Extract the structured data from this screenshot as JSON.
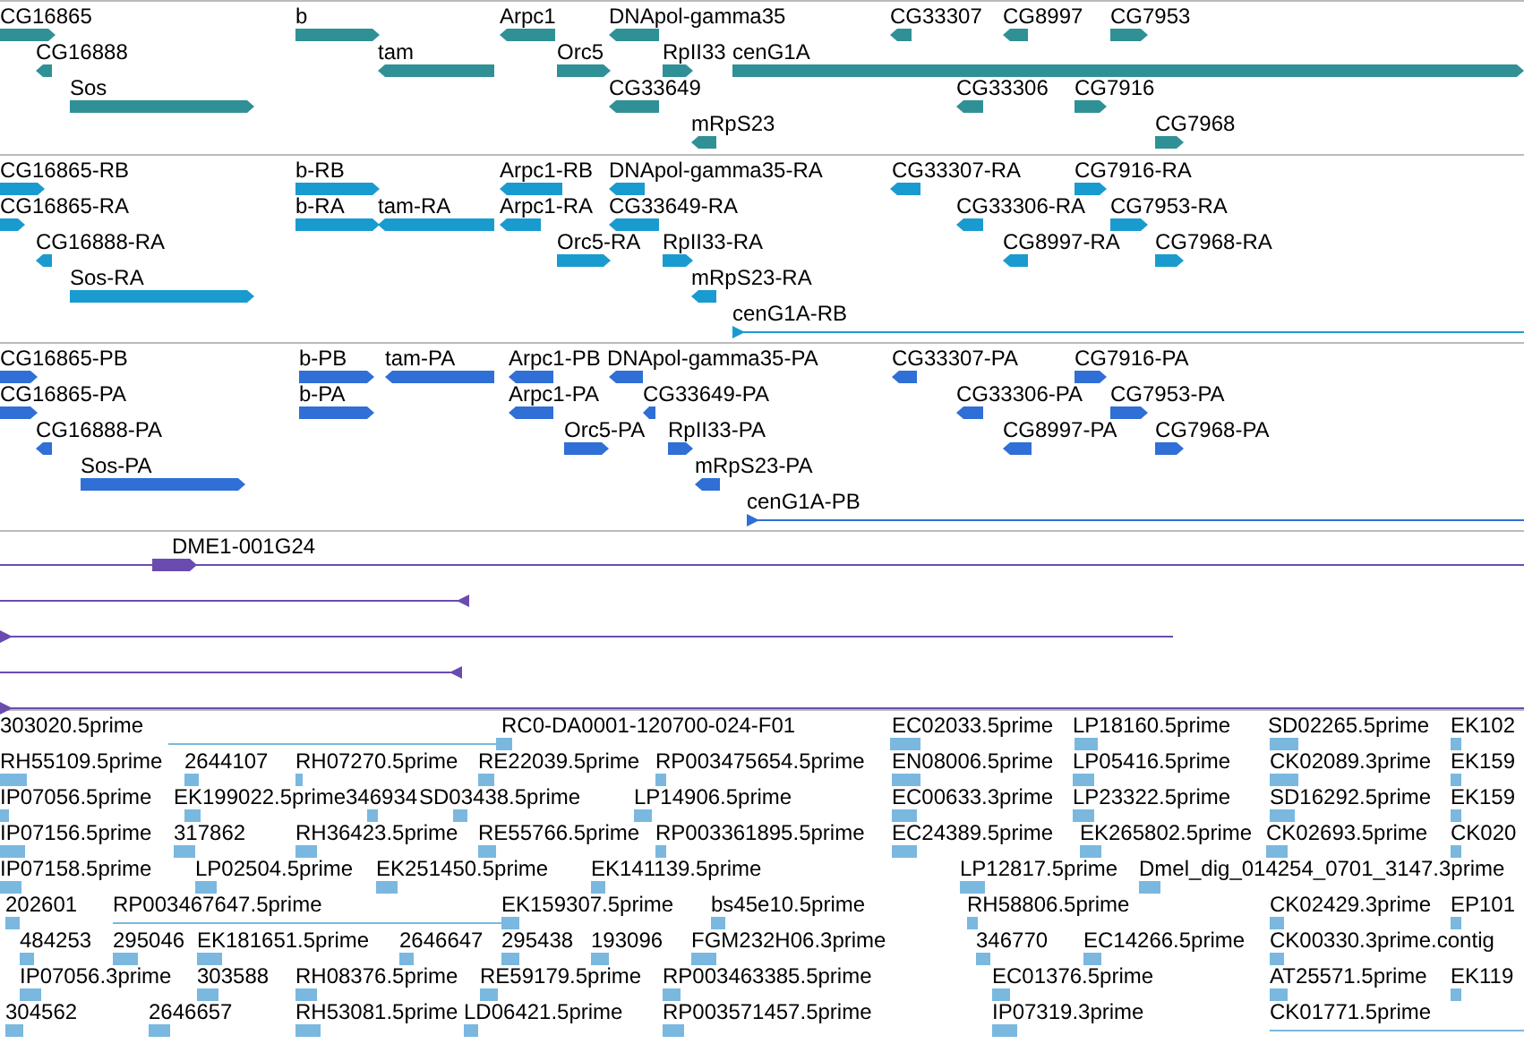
{
  "tracks": [
    {
      "kind": "gene",
      "features": [
        {
          "label": "CG16865",
          "reverse": false
        },
        {
          "label": "b",
          "reverse": false
        },
        {
          "label": "Arpc1",
          "reverse": true
        },
        {
          "label": "DNApol-gamma35",
          "reverse": true
        },
        {
          "label": "CG33307",
          "reverse": true
        },
        {
          "label": "CG8997",
          "reverse": true
        },
        {
          "label": "CG7953",
          "reverse": false
        },
        {
          "label": "CG16888",
          "reverse": true
        },
        {
          "label": "tam",
          "reverse": true
        },
        {
          "label": "Orc5",
          "reverse": false
        },
        {
          "label": "RpII33",
          "reverse": false
        },
        {
          "label": "cenG1A",
          "reverse": false
        },
        {
          "label": "Sos",
          "reverse": false
        },
        {
          "label": "CG33649",
          "reverse": true
        },
        {
          "label": "CG33306",
          "reverse": true
        },
        {
          "label": "CG7916",
          "reverse": false
        },
        {
          "label": "mRpS23",
          "reverse": true
        },
        {
          "label": "CG7968",
          "reverse": false
        }
      ]
    },
    {
      "kind": "transcript",
      "features": [
        {
          "label": "CG16865-RB",
          "reverse": false
        },
        {
          "label": "b-RB",
          "reverse": false
        },
        {
          "label": "Arpc1-RB",
          "reverse": true
        },
        {
          "label": "DNApol-gamma35-RA",
          "reverse": true
        },
        {
          "label": "CG33307-RA",
          "reverse": true
        },
        {
          "label": "CG7916-RA",
          "reverse": false
        },
        {
          "label": "CG16865-RA",
          "reverse": false
        },
        {
          "label": "b-RA",
          "reverse": false
        },
        {
          "label": "tam-RA",
          "reverse": true
        },
        {
          "label": "Arpc1-RA",
          "reverse": true
        },
        {
          "label": "CG33649-RA",
          "reverse": true
        },
        {
          "label": "CG33306-RA",
          "reverse": true
        },
        {
          "label": "CG7953-RA",
          "reverse": false
        },
        {
          "label": "CG16888-RA",
          "reverse": true
        },
        {
          "label": "Orc5-RA",
          "reverse": false
        },
        {
          "label": "RpII33-RA",
          "reverse": false
        },
        {
          "label": "CG8997-RA",
          "reverse": true
        },
        {
          "label": "CG7968-RA",
          "reverse": false
        },
        {
          "label": "Sos-RA",
          "reverse": false
        },
        {
          "label": "mRpS23-RA",
          "reverse": true
        },
        {
          "label": "cenG1A-RB",
          "reverse": false
        }
      ]
    },
    {
      "kind": "protein",
      "features": [
        {
          "label": "CG16865-PB",
          "reverse": false
        },
        {
          "label": "b-PB",
          "reverse": false
        },
        {
          "label": "tam-PA",
          "reverse": true
        },
        {
          "label": "Arpc1-PB",
          "reverse": true
        },
        {
          "label": "DNApol-gamma35-PA",
          "reverse": true
        },
        {
          "label": "CG33307-PA",
          "reverse": true
        },
        {
          "label": "CG7916-PA",
          "reverse": false
        },
        {
          "label": "CG16865-PA",
          "reverse": false
        },
        {
          "label": "b-PA",
          "reverse": false
        },
        {
          "label": "Arpc1-PA",
          "reverse": true
        },
        {
          "label": "CG33649-PA",
          "reverse": true
        },
        {
          "label": "CG33306-PA",
          "reverse": true
        },
        {
          "label": "CG7953-PA",
          "reverse": false
        },
        {
          "label": "CG16888-PA",
          "reverse": true
        },
        {
          "label": "Orc5-PA",
          "reverse": false
        },
        {
          "label": "RpII33-PA",
          "reverse": false
        },
        {
          "label": "CG8997-PA",
          "reverse": true
        },
        {
          "label": "CG7968-PA",
          "reverse": false
        },
        {
          "label": "Sos-PA",
          "reverse": false
        },
        {
          "label": "mRpS23-PA",
          "reverse": true
        },
        {
          "label": "cenG1A-PB",
          "reverse": false
        }
      ]
    },
    {
      "kind": "clone",
      "features": [
        {
          "label": "DME1-001G24",
          "reverse": false
        },
        {
          "reverse": true
        },
        {
          "reverse": false
        },
        {
          "reverse": true
        },
        {
          "reverse": false
        }
      ]
    },
    {
      "kind": "est",
      "features": [
        {
          "label": "303020.5prime"
        },
        {
          "label": "RC0-DA0001-120700-024-F01"
        },
        {
          "label": "EC02033.5prime"
        },
        {
          "label": "LP18160.5prime"
        },
        {
          "label": "SD02265.5prime"
        },
        {
          "label": "EK102"
        },
        {
          "label": "RH55109.5prime"
        },
        {
          "label": "2644107"
        },
        {
          "label": "RH07270.5prime"
        },
        {
          "label": "RE22039.5prime"
        },
        {
          "label": "RP003475654.5prime"
        },
        {
          "label": "EN08006.5prime"
        },
        {
          "label": "LP05416.5prime"
        },
        {
          "label": "CK02089.3prime"
        },
        {
          "label": "EK159"
        },
        {
          "label": "IP07056.5prime"
        },
        {
          "label": "EK199022.5prime"
        },
        {
          "label": "346934"
        },
        {
          "label": "SD03438.5prime"
        },
        {
          "label": "LP14906.5prime"
        },
        {
          "label": "EC00633.3prime"
        },
        {
          "label": "LP23322.5prime"
        },
        {
          "label": "SD16292.5prime"
        },
        {
          "label": "EK159"
        },
        {
          "label": "IP07156.5prime"
        },
        {
          "label": "317862"
        },
        {
          "label": "RH36423.5prime"
        },
        {
          "label": "RE55766.5prime"
        },
        {
          "label": "RP003361895.5prime"
        },
        {
          "label": "EC24389.5prime"
        },
        {
          "label": "EK265802.5prime"
        },
        {
          "label": "CK02693.5prime"
        },
        {
          "label": "CK020"
        },
        {
          "label": "IP07158.5prime"
        },
        {
          "label": "LP02504.5prime"
        },
        {
          "label": "EK251450.5prime"
        },
        {
          "label": "EK141139.5prime"
        },
        {
          "label": "LP12817.5prime"
        },
        {
          "label": "Dmel_dig_014254_0701_3147.3prime"
        },
        {
          "label": "202601"
        },
        {
          "label": "RP003467647.5prime"
        },
        {
          "label": "EK159307.5prime"
        },
        {
          "label": "bs45e10.5prime"
        },
        {
          "label": "RH58806.5prime"
        },
        {
          "label": "CK02429.3prime"
        },
        {
          "label": "EP101"
        },
        {
          "label": "484253"
        },
        {
          "label": "295046"
        },
        {
          "label": "EK181651.5prime"
        },
        {
          "label": "2646647"
        },
        {
          "label": "295438"
        },
        {
          "label": "193096"
        },
        {
          "label": "FGM232H06.3prime"
        },
        {
          "label": "346770"
        },
        {
          "label": "EC14266.5prime"
        },
        {
          "label": "CK00330.3prime.contig"
        },
        {
          "label": "IP07056.3prime"
        },
        {
          "label": "303588"
        },
        {
          "label": "RH08376.5prime"
        },
        {
          "label": "RE59179.5prime"
        },
        {
          "label": "RP003463385.5prime"
        },
        {
          "label": "EC01376.5prime"
        },
        {
          "label": "AT25571.5prime"
        },
        {
          "label": "EK119"
        },
        {
          "label": "304562"
        },
        {
          "label": "2646657"
        },
        {
          "label": "RH53081.5prime"
        },
        {
          "label": "LD06421.5prime"
        },
        {
          "label": "RP003571457.5prime"
        },
        {
          "label": "IP07319.3prime"
        },
        {
          "label": "CK01771.5prime"
        }
      ]
    }
  ]
}
